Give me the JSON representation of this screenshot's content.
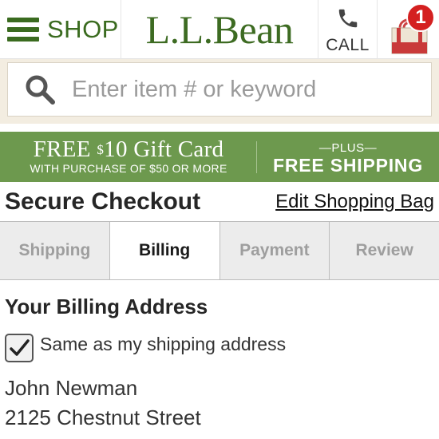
{
  "header": {
    "shop_label": "SHOP",
    "logo_text": "L.L.Bean",
    "call_label": "CALL",
    "bag_count": "1",
    "brand_color": "#3a6b1f",
    "badge_color": "#d42020"
  },
  "search": {
    "placeholder": "Enter item # or keyword",
    "value": ""
  },
  "promo": {
    "free": "FREE",
    "dollar_sign": "$",
    "gift_card": "10 Gift Card",
    "sub": "WITH PURCHASE OF $50 OR MORE",
    "plus": "—PLUS—",
    "shipping": "FREE SHIPPING",
    "bg_color": "#6d994e"
  },
  "checkout": {
    "title": "Secure Checkout",
    "edit_link": "Edit Shopping Bag",
    "steps": [
      {
        "label": "Shipping",
        "active": false
      },
      {
        "label": "Billing",
        "active": true
      },
      {
        "label": "Payment",
        "active": false
      },
      {
        "label": "Review",
        "active": false
      }
    ]
  },
  "billing": {
    "title": "Your Billing Address",
    "same_as_shipping_label": "Same as my shipping address",
    "same_as_shipping_checked": true,
    "name": "John Newman",
    "street": "2125 Chestnut Street"
  }
}
